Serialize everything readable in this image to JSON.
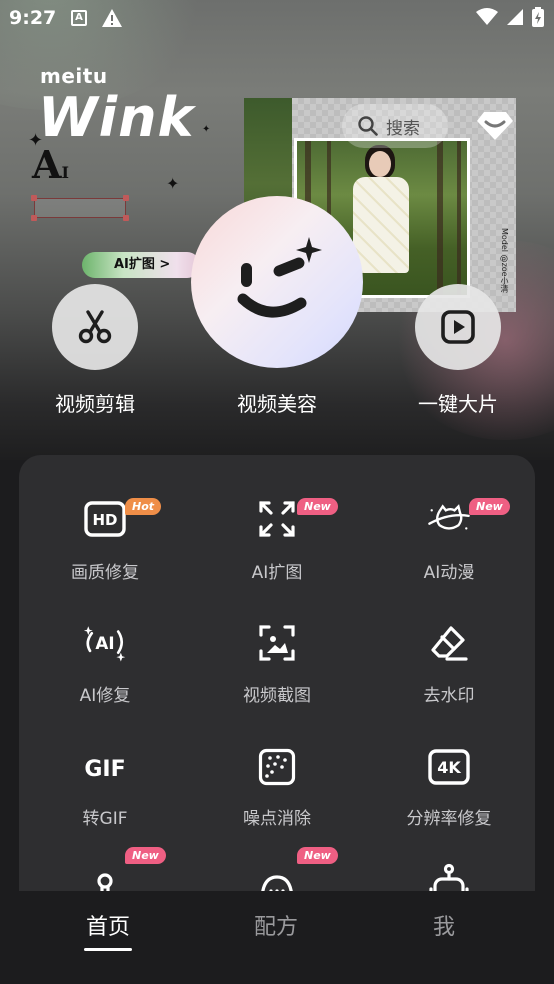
{
  "status_bar": {
    "time": "9:27",
    "left_icons": [
      "a-notification-icon",
      "warning-icon"
    ],
    "right_icons": [
      "wifi-icon",
      "cell-signal-icon",
      "battery-icon"
    ]
  },
  "brand": {
    "meitu": "meitu",
    "wink": "Wink",
    "ai": "A",
    "ai_small": "I"
  },
  "banner": {
    "ai_expand_button": "AI扩图 >",
    "model_credit": "Model @zoe小清"
  },
  "search": {
    "placeholder": "搜索"
  },
  "hero_actions": [
    {
      "label": "视频剪辑",
      "icon": "scissors-icon"
    },
    {
      "label": "视频美容",
      "icon": "wink-face-icon"
    },
    {
      "label": "一键大片",
      "icon": "play-icon"
    }
  ],
  "tools": [
    {
      "label": "画质修复",
      "icon": "hd-icon",
      "badge": "Hot"
    },
    {
      "label": "AI扩图",
      "icon": "expand-icon",
      "badge": "New"
    },
    {
      "label": "AI动漫",
      "icon": "planet-cat-icon",
      "badge": "New"
    },
    {
      "label": "AI修复",
      "icon": "ai-sparkle-icon",
      "badge": ""
    },
    {
      "label": "视频截图",
      "icon": "screenshot-icon",
      "badge": ""
    },
    {
      "label": "去水印",
      "icon": "eraser-icon",
      "badge": ""
    },
    {
      "label": "转GIF",
      "icon": "gif-icon",
      "badge": ""
    },
    {
      "label": "噪点消除",
      "icon": "noise-icon",
      "badge": ""
    },
    {
      "label": "分辨率修复",
      "icon": "4k-icon",
      "badge": ""
    },
    {
      "label": "",
      "icon": "figure-icon",
      "badge": "New"
    },
    {
      "label": "",
      "icon": "face-icon",
      "badge": "New"
    },
    {
      "label": "",
      "icon": "robot-icon",
      "badge": ""
    }
  ],
  "icon_text": {
    "hd": "HD",
    "gif": "GIF",
    "fourk": "4K",
    "ai": "AI"
  },
  "tabs": [
    {
      "label": "首页",
      "active": true
    },
    {
      "label": "配方",
      "active": false
    },
    {
      "label": "我",
      "active": false
    }
  ],
  "colors": {
    "badge_hot": "#ef8e48",
    "badge_new": "#ef5f83",
    "card_bg": "#2e2e30",
    "page_bg": "#1c1c1e"
  }
}
